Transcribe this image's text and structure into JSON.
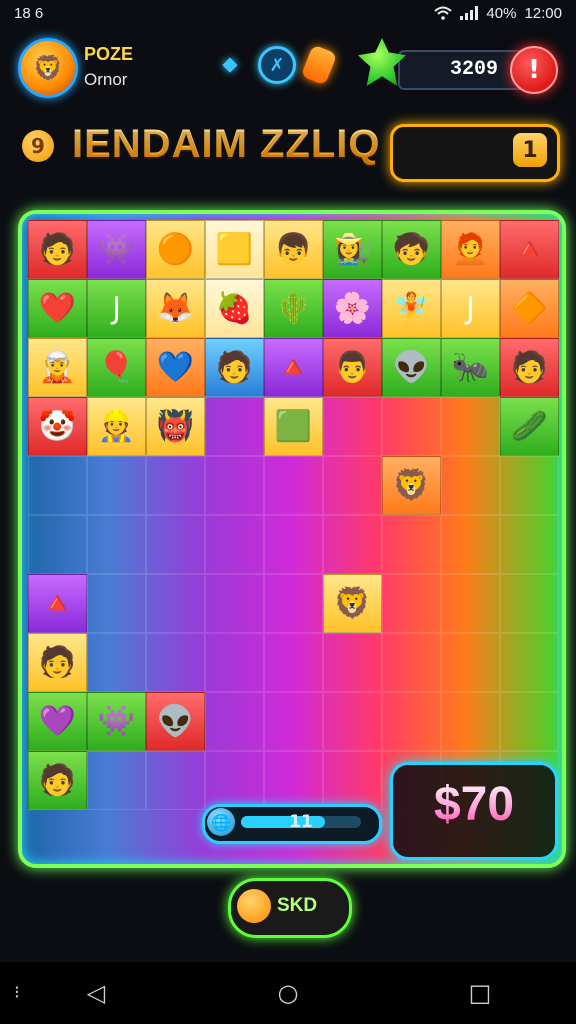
{
  "status_bar": {
    "time_left": "18 6",
    "battery": "40%",
    "clock": "12:00"
  },
  "header": {
    "player_name": "POZE",
    "player_sub": "Ornor",
    "coins": "3209",
    "alert": "!"
  },
  "title": {
    "text": "IENDAIM ZZLIQ",
    "icon_label": "9",
    "level": "1"
  },
  "board": {
    "rows": [
      [
        {
          "c": "t-red",
          "i": "🧑"
        },
        {
          "c": "t-purple",
          "i": "👾"
        },
        {
          "c": "t-yellow",
          "i": "🟠"
        },
        {
          "c": "t-cream",
          "i": "🟨"
        },
        {
          "c": "t-yellow",
          "i": "👦"
        },
        {
          "c": "t-green",
          "i": "👩‍🌾"
        },
        {
          "c": "t-green",
          "i": "🧒"
        },
        {
          "c": "t-orange",
          "i": "🧑‍🦰"
        },
        {
          "c": "t-red",
          "i": "🔺"
        }
      ],
      [
        {
          "c": "t-green",
          "i": "❤️"
        },
        {
          "c": "t-green",
          "i": "J"
        },
        {
          "c": "t-yellow",
          "i": "🦊"
        },
        {
          "c": "t-cream",
          "i": "🍓"
        },
        {
          "c": "t-green",
          "i": "🌵"
        },
        {
          "c": "t-purple",
          "i": "🌸"
        },
        {
          "c": "t-yellow",
          "i": "🧚"
        },
        {
          "c": "t-yellow",
          "i": "J"
        },
        {
          "c": "t-orange",
          "i": "🔶"
        }
      ],
      [
        {
          "c": "t-yellow",
          "i": "🧝"
        },
        {
          "c": "t-green",
          "i": "🎈"
        },
        {
          "c": "t-orange",
          "i": "💙"
        },
        {
          "c": "t-blue",
          "i": "🧑"
        },
        {
          "c": "t-purple",
          "i": "🔺"
        },
        {
          "c": "t-red",
          "i": "👨"
        },
        {
          "c": "t-green",
          "i": "👽"
        },
        {
          "c": "t-green",
          "i": "🐜"
        },
        {
          "c": "t-red",
          "i": "🧑"
        }
      ],
      [
        {
          "c": "t-red",
          "i": "🤡"
        },
        {
          "c": "t-yellow",
          "i": "👷"
        },
        {
          "c": "t-yellow",
          "i": "👹"
        },
        {
          "c": "empty",
          "i": ""
        },
        {
          "c": "t-yellow",
          "i": "🟩"
        },
        {
          "c": "empty",
          "i": ""
        },
        {
          "c": "empty",
          "i": ""
        },
        {
          "c": "empty",
          "i": ""
        },
        {
          "c": "t-green",
          "i": "🥒"
        }
      ],
      [
        {
          "c": "empty",
          "i": ""
        },
        {
          "c": "empty",
          "i": ""
        },
        {
          "c": "empty",
          "i": ""
        },
        {
          "c": "empty",
          "i": ""
        },
        {
          "c": "empty",
          "i": ""
        },
        {
          "c": "empty",
          "i": ""
        },
        {
          "c": "t-orange",
          "i": "🦁"
        },
        {
          "c": "empty",
          "i": ""
        },
        {
          "c": "empty",
          "i": ""
        }
      ],
      [
        {
          "c": "empty",
          "i": ""
        },
        {
          "c": "empty",
          "i": ""
        },
        {
          "c": "empty",
          "i": ""
        },
        {
          "c": "empty",
          "i": ""
        },
        {
          "c": "empty",
          "i": ""
        },
        {
          "c": "empty",
          "i": ""
        },
        {
          "c": "empty",
          "i": ""
        },
        {
          "c": "empty",
          "i": ""
        },
        {
          "c": "empty",
          "i": ""
        }
      ],
      [
        {
          "c": "t-purple",
          "i": "🔺"
        },
        {
          "c": "empty",
          "i": ""
        },
        {
          "c": "empty",
          "i": ""
        },
        {
          "c": "empty",
          "i": ""
        },
        {
          "c": "empty",
          "i": ""
        },
        {
          "c": "t-yellow",
          "i": "🦁"
        },
        {
          "c": "empty",
          "i": ""
        },
        {
          "c": "empty",
          "i": ""
        },
        {
          "c": "empty",
          "i": ""
        }
      ],
      [
        {
          "c": "t-yellow",
          "i": "🧑"
        },
        {
          "c": "empty",
          "i": ""
        },
        {
          "c": "empty",
          "i": ""
        },
        {
          "c": "empty",
          "i": ""
        },
        {
          "c": "empty",
          "i": ""
        },
        {
          "c": "empty",
          "i": ""
        },
        {
          "c": "empty",
          "i": ""
        },
        {
          "c": "empty",
          "i": ""
        },
        {
          "c": "empty",
          "i": ""
        }
      ],
      [
        {
          "c": "t-green",
          "i": "💜"
        },
        {
          "c": "t-green",
          "i": "👾"
        },
        {
          "c": "t-red",
          "i": "👽"
        },
        {
          "c": "empty",
          "i": ""
        },
        {
          "c": "empty",
          "i": ""
        },
        {
          "c": "empty",
          "i": ""
        },
        {
          "c": "empty",
          "i": ""
        },
        {
          "c": "empty",
          "i": ""
        },
        {
          "c": "empty",
          "i": ""
        }
      ],
      [
        {
          "c": "t-green",
          "i": "🧑"
        },
        {
          "c": "empty",
          "i": ""
        },
        {
          "c": "empty",
          "i": ""
        },
        {
          "c": "empty",
          "i": ""
        },
        {
          "c": "empty",
          "i": ""
        },
        {
          "c": "empty",
          "i": ""
        },
        {
          "c": "empty",
          "i": ""
        },
        {
          "c": "empty",
          "i": ""
        },
        {
          "c": "empty",
          "i": ""
        }
      ]
    ]
  },
  "progress": {
    "label": "11",
    "fill_fraction": 0.7
  },
  "score": "$70",
  "skip_button": {
    "label": "SKD"
  }
}
